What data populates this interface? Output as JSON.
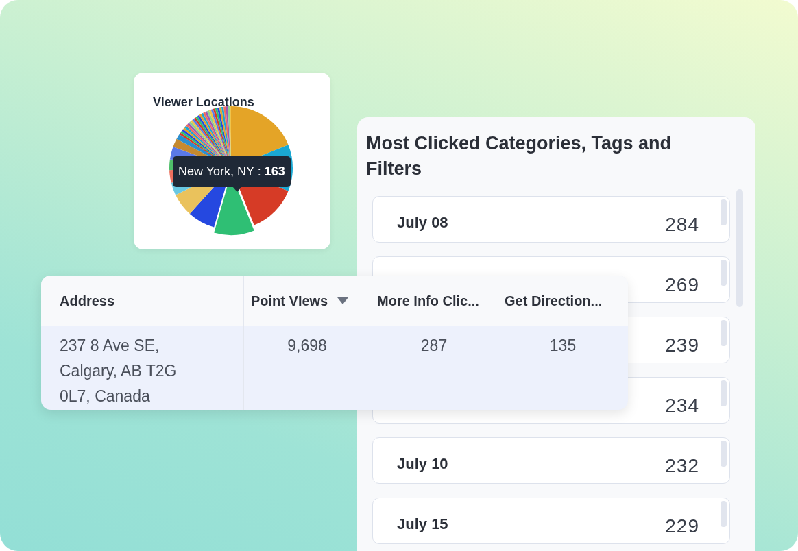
{
  "viewer_locations": {
    "title": "Viewer Locations",
    "tooltip": "New York, NY : **163**"
  },
  "categories_panel": {
    "title": "Most Clicked Categories, Tags and Filters",
    "items": [
      {
        "label": "July 08",
        "count": "284"
      },
      {
        "count": "269"
      },
      {
        "count": "239"
      },
      {
        "count": "234"
      },
      {
        "label": "July 10",
        "count": "232"
      },
      {
        "label": "July 15",
        "count": "229"
      }
    ]
  },
  "table": {
    "columns": [
      {
        "label": "Address",
        "sorted": false
      },
      {
        "label": "Point VIews",
        "sorted": true
      },
      {
        "label": "More Info Clic...",
        "sorted": false
      },
      {
        "label": "Get Direction...",
        "sorted": false
      }
    ],
    "rows": [
      {
        "cells": [
          "237 8 Ave SE, Calgary, AB T2G 0L7, Canada",
          "9,698",
          "287",
          "135"
        ]
      }
    ]
  }
}
